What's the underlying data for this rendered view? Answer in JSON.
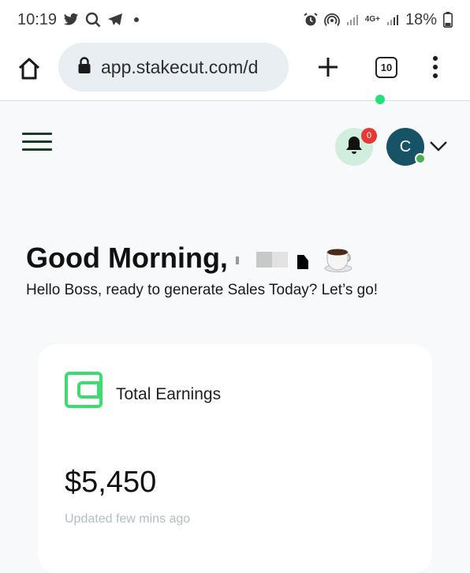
{
  "status_bar": {
    "time": "10:19",
    "battery": "18%",
    "network": "4G+",
    "left_icons": [
      "twitter-icon",
      "search-icon",
      "telegram-icon",
      "dot-icon"
    ],
    "right_icons": [
      "alarm-icon",
      "hotspot-icon",
      "signal-icon",
      "battery-icon"
    ]
  },
  "browser": {
    "url": "app.stakecut.com/d",
    "tab_count": "10",
    "icons": [
      "home-icon",
      "lock-icon",
      "plus-icon",
      "more-icon"
    ]
  },
  "header": {
    "notification_count": "0",
    "avatar_initial": "C"
  },
  "greeting": {
    "title": "Good Morning,",
    "subtitle": "Hello Boss, ready to generate Sales Today? Let’s go!"
  },
  "earnings_card": {
    "title": "Total Earnings",
    "amount": "$5,450",
    "updated": "Updated few mins ago"
  },
  "colors": {
    "accent_green": "#3ddc71",
    "avatar_bg": "#175366",
    "badge_red": "#e53935",
    "bell_bg": "#cfeedd"
  }
}
